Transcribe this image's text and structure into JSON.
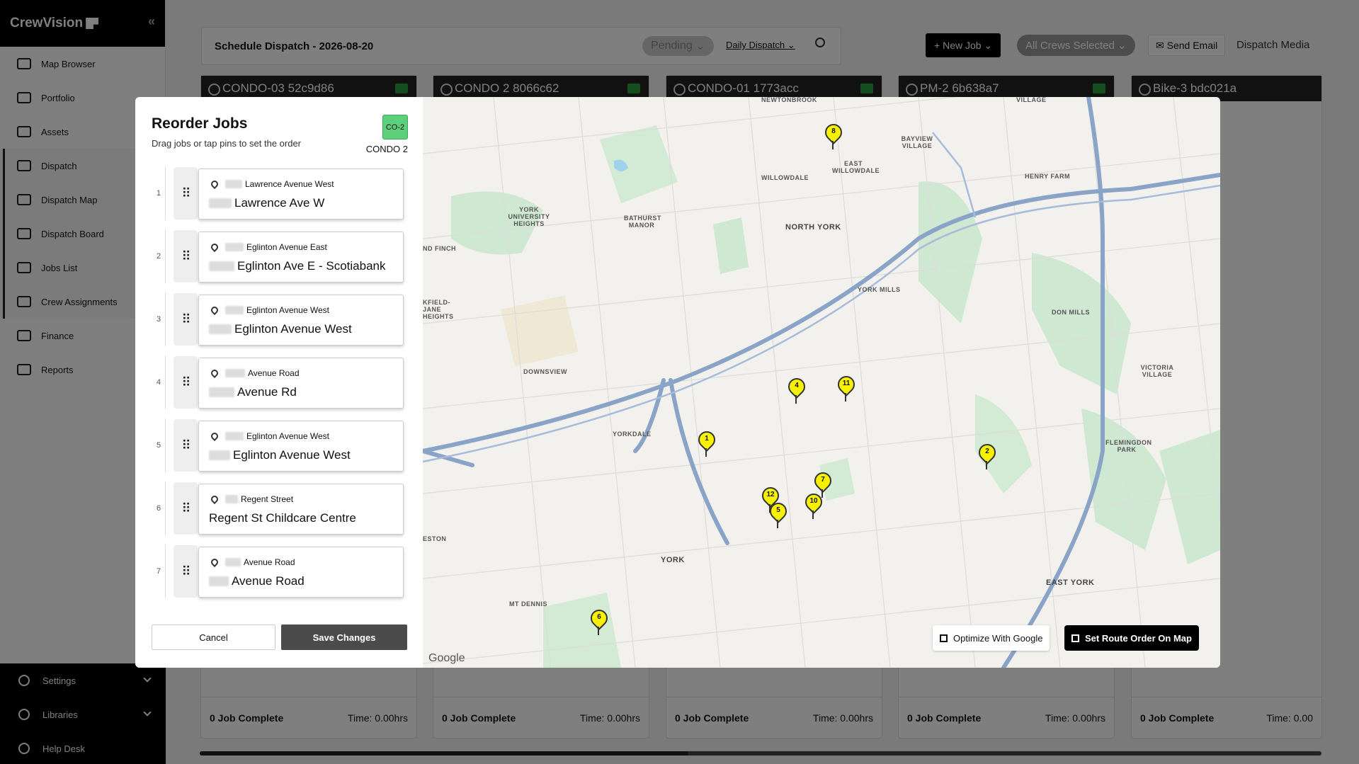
{
  "app": {
    "brand": "CrewVision"
  },
  "sidebar": {
    "items": [
      {
        "label": "Map Browser",
        "icon": "map-icon"
      },
      {
        "label": "Portfolio",
        "icon": "grid-icon"
      },
      {
        "label": "Assets",
        "icon": "truck-icon"
      },
      {
        "label": "Dispatch",
        "icon": "dispatch-icon"
      },
      {
        "label": "Dispatch Map",
        "icon": "monitor-icon"
      },
      {
        "label": "Dispatch Board",
        "icon": "board-icon"
      },
      {
        "label": "Jobs List",
        "icon": "list-icon"
      },
      {
        "label": "Crew Assignments",
        "icon": "clipboard-icon"
      },
      {
        "label": "Finance",
        "icon": "finance-icon"
      },
      {
        "label": "Reports",
        "icon": "report-icon"
      }
    ],
    "bottom": [
      {
        "label": "Settings",
        "icon": "gear-icon"
      },
      {
        "label": "Libraries",
        "icon": "library-icon"
      },
      {
        "label": "Help Desk",
        "icon": "help-icon"
      }
    ]
  },
  "topbar": {
    "title": "Schedule Dispatch - 2026-08-20",
    "status": "Pending",
    "view": "Daily Dispatch",
    "new_job": "New Job",
    "crews": "All Crews Selected",
    "send_email": "Send Email",
    "media": "Dispatch Media"
  },
  "crews": [
    {
      "name": "CONDO-03 52c9d86",
      "foot_done": "0 Job Complete",
      "foot_time": "Time: 0.00hrs"
    },
    {
      "name": "CONDO 2 8066c62",
      "foot_done": "0 Job Complete",
      "foot_time": "Time: 0.00hrs"
    },
    {
      "name": "CONDO-01 1773acc",
      "foot_done": "0 Job Complete",
      "foot_time": "Time: 0.00hrs"
    },
    {
      "name": "PM-2 6b638a7",
      "foot_done": "0 Job Complete",
      "foot_time": "Time: 0.00hrs"
    },
    {
      "name": "Bike-3 bdc021a",
      "foot_done": "0 Job Complete",
      "foot_time": "Time: 0.00"
    }
  ],
  "modal": {
    "title": "Reorder Jobs",
    "subtitle": "Drag jobs or tap pins to set the order",
    "crew_code": "CO-2",
    "crew_name": "CONDO 2",
    "jobs": [
      {
        "num": "1",
        "street": "Lawrence Avenue West",
        "name": "Lawrence Ave W"
      },
      {
        "num": "2",
        "street": "Eglinton Avenue East",
        "name": "Eglinton Ave E - Scotiabank"
      },
      {
        "num": "3",
        "street": "Eglinton Avenue West",
        "name": "Eglinton Avenue West"
      },
      {
        "num": "4",
        "street": "Avenue Road",
        "name": "Avenue Rd"
      },
      {
        "num": "5",
        "street": "Eglinton Avenue West",
        "name": "Eglinton Avenue West"
      },
      {
        "num": "6",
        "street": "Regent Street",
        "name": "Regent St Childcare Centre"
      },
      {
        "num": "7",
        "street": "Avenue Road",
        "name": "Avenue Road"
      }
    ],
    "cancel": "Cancel",
    "save": "Save Changes",
    "optimize": "Optimize With Google",
    "set_route": "Set Route Order On Map",
    "map_attrib": "Google"
  },
  "map": {
    "labels": [
      "NEWTONBROOK",
      "VILLAGE",
      "BAYVIEW VILLAGE",
      "EAST WILLOWDALE",
      "WILLOWDALE",
      "HENRY FARM",
      "YORK UNIVERSITY HEIGHTS",
      "BATHURST MANOR",
      "NORTH YORK",
      "ND FINCH",
      "YORK MILLS",
      "DON MILLS",
      "KFIELD-JANE HEIGHTS",
      "DOWNSVIEW",
      "VICTORIA VILLAGE",
      "YORKDALE",
      "FLEMINGDON PARK",
      "YORK",
      "ESTON",
      "EAST YORK",
      "MT DENNIS"
    ],
    "markers": [
      "8",
      "4",
      "11",
      "1",
      "2",
      "7",
      "12",
      "10",
      "5",
      "6"
    ]
  }
}
